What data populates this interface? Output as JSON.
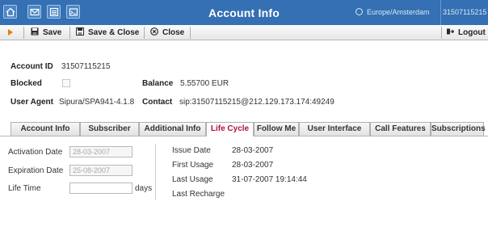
{
  "titlebar": {
    "title": "Account Info",
    "timezone": "Europe/Amsterdam",
    "account": "31507115215",
    "icons": [
      "home-icon",
      "mail-icon",
      "list-icon",
      "terminal-icon"
    ]
  },
  "toolbar": {
    "save_label": "Save",
    "save_close_label": "Save & Close",
    "close_label": "Close",
    "logout_label": "Logout"
  },
  "info": {
    "account_id_label": "Account ID",
    "account_id_value": "31507115215",
    "blocked_label": "Blocked",
    "blocked_checked": false,
    "balance_label": "Balance",
    "balance_value": "5.55700 EUR",
    "user_agent_label": "User Agent",
    "user_agent_value": "Sipura/SPA941-4.1.8",
    "contact_label": "Contact",
    "contact_value": "sip:31507115215@212.129.173.174:49249"
  },
  "tabs": [
    {
      "label": "Account Info",
      "active": false
    },
    {
      "label": "Subscriber",
      "active": false
    },
    {
      "label": "Additional Info",
      "active": false
    },
    {
      "label": "Life Cycle",
      "active": true
    },
    {
      "label": "Follow Me",
      "active": false
    },
    {
      "label": "User Interface",
      "active": false
    },
    {
      "label": "Call Features",
      "active": false
    },
    {
      "label": "Subscriptions",
      "active": false
    }
  ],
  "lifecycle": {
    "activation_label": "Activation Date",
    "activation_value": "28-03-2007",
    "expiration_label": "Expiration Date",
    "expiration_value": "25-08-2007",
    "lifetime_label": "Life Time",
    "lifetime_value": "",
    "lifetime_unit": "days",
    "issue_label": "Issue Date",
    "issue_value": "28-03-2007",
    "first_usage_label": "First Usage",
    "first_usage_value": "28-03-2007",
    "last_usage_label": "Last Usage",
    "last_usage_value": "31-07-2007 19:14:44",
    "last_recharge_label": "Last Recharge",
    "last_recharge_value": ""
  },
  "colors": {
    "titlebar_bg": "#3470b3",
    "active_tab_text": "#b0123a",
    "toolbar_arrow": "#e07d10"
  }
}
